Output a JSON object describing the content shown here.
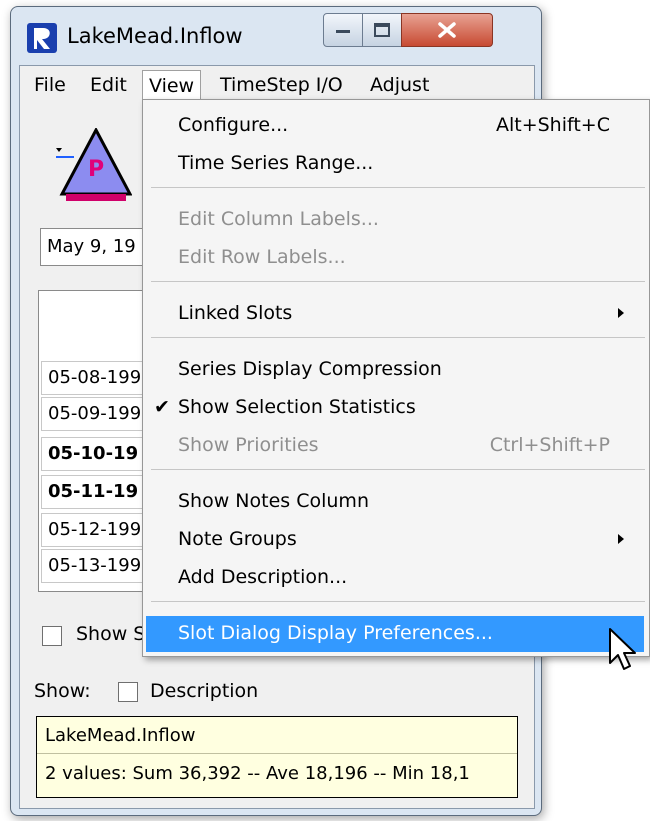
{
  "window": {
    "title": "LakeMead.Inflow"
  },
  "menubar": {
    "items": [
      {
        "label": "File"
      },
      {
        "label": "Edit"
      },
      {
        "label": "View"
      },
      {
        "label": "TimeStep I/O"
      },
      {
        "label": "Adjust"
      }
    ]
  },
  "object_icon": {
    "letter": "P"
  },
  "date_field": {
    "value": "May 9, 19"
  },
  "table": {
    "rows": [
      {
        "label": "05-08-199"
      },
      {
        "label": "05-09-199"
      },
      {
        "label": "05-10-19"
      },
      {
        "label": "05-11-19"
      },
      {
        "label": "05-12-199"
      },
      {
        "label": "05-13-199"
      }
    ]
  },
  "show_s_checkbox": {
    "label": "Show S"
  },
  "show_row": {
    "label": "Show:",
    "description_label": "Description"
  },
  "status": {
    "slot_name": "LakeMead.Inflow",
    "stats": "2 values:  Sum 36,392 -- Ave 18,196 -- Min 18,1"
  },
  "view_menu": {
    "items": [
      {
        "label": "Configure...",
        "shortcut": "Alt+Shift+C"
      },
      {
        "label": "Time Series Range..."
      },
      {
        "label": "Edit Column Labels..."
      },
      {
        "label": "Edit Row Labels..."
      },
      {
        "label": "Linked Slots"
      },
      {
        "label": "Series Display Compression"
      },
      {
        "label": "Show Selection Statistics"
      },
      {
        "label": "Show Priorities",
        "shortcut": "Ctrl+Shift+P"
      },
      {
        "label": "Show Notes Column"
      },
      {
        "label": "Note Groups"
      },
      {
        "label": "Add Description..."
      },
      {
        "label": "Slot Dialog Display Preferences..."
      }
    ]
  },
  "colors": {
    "highlight": "#3399ff",
    "icon_fill": "#8c8cf0",
    "icon_letter": "#e0007a"
  }
}
